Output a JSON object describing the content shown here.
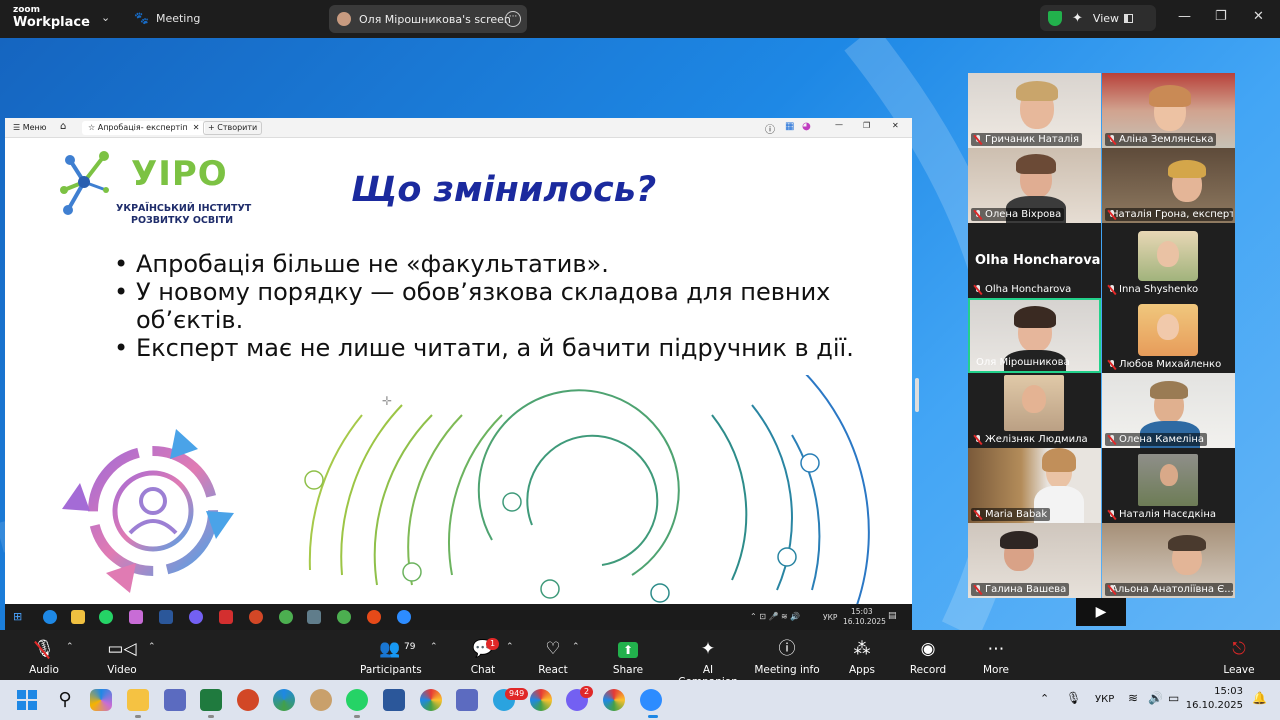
{
  "topbar": {
    "logo_small": "zoom",
    "logo_big": "Workplace",
    "meeting_label": "Meeting",
    "screen_pill_label": "Оля Мірошникова's screen",
    "view_label": "View"
  },
  "ppt": {
    "menu_label": "Меню",
    "tab_label": "Апробація- експертіп",
    "new_label": "Створити"
  },
  "slide": {
    "logo_name": "УІРО",
    "logo_line1": "УКРАЇНСЬКИЙ ІНСТИТУТ",
    "logo_line2": "РОЗВИТКУ ОСВІТИ",
    "title": "Що змінилось?",
    "bullets": [
      "Апробація більше не «факультатив».",
      "У новому порядку — обов’язкова складова для певних об’єктів.",
      "Експерт має не лише читати, а й бачити підручник в дії."
    ]
  },
  "inner_taskbar": {
    "lang": "УКР",
    "time": "15:03",
    "date": "16.10.2025"
  },
  "participants": [
    {
      "name": "Гричаник Наталія"
    },
    {
      "name": "Аліна Землянська"
    },
    {
      "name": "Олена Віхрова"
    },
    {
      "name": "Наталія Грона, експерт"
    },
    {
      "name": "Olha Honcharova",
      "display_name": "Olha Honcharova"
    },
    {
      "name": "Inna Shyshenko"
    },
    {
      "name": "Оля Мірошникова"
    },
    {
      "name": "Любов Михайленко"
    },
    {
      "name": "Желізняк Людмила"
    },
    {
      "name": "Олена Камеліна"
    },
    {
      "name": "Maria Babak"
    },
    {
      "name": "Наталія Насєдкіна"
    },
    {
      "name": "Галина Вашева"
    },
    {
      "name": "Альона Анатоліївна Є..."
    }
  ],
  "toolbar": {
    "audio": "Audio",
    "video": "Video",
    "participants": "Participants",
    "participants_count": "79",
    "chat": "Chat",
    "chat_badge": "1",
    "react": "React",
    "share": "Share",
    "ai": "AI Companion",
    "meeting_info": "Meeting info",
    "apps": "Apps",
    "record": "Record",
    "more": "More",
    "leave": "Leave"
  },
  "win_taskbar": {
    "lang": "УКР",
    "time": "15:03",
    "date": "16.10.2025",
    "badge_telegram": "949",
    "badge_viber": "2"
  }
}
